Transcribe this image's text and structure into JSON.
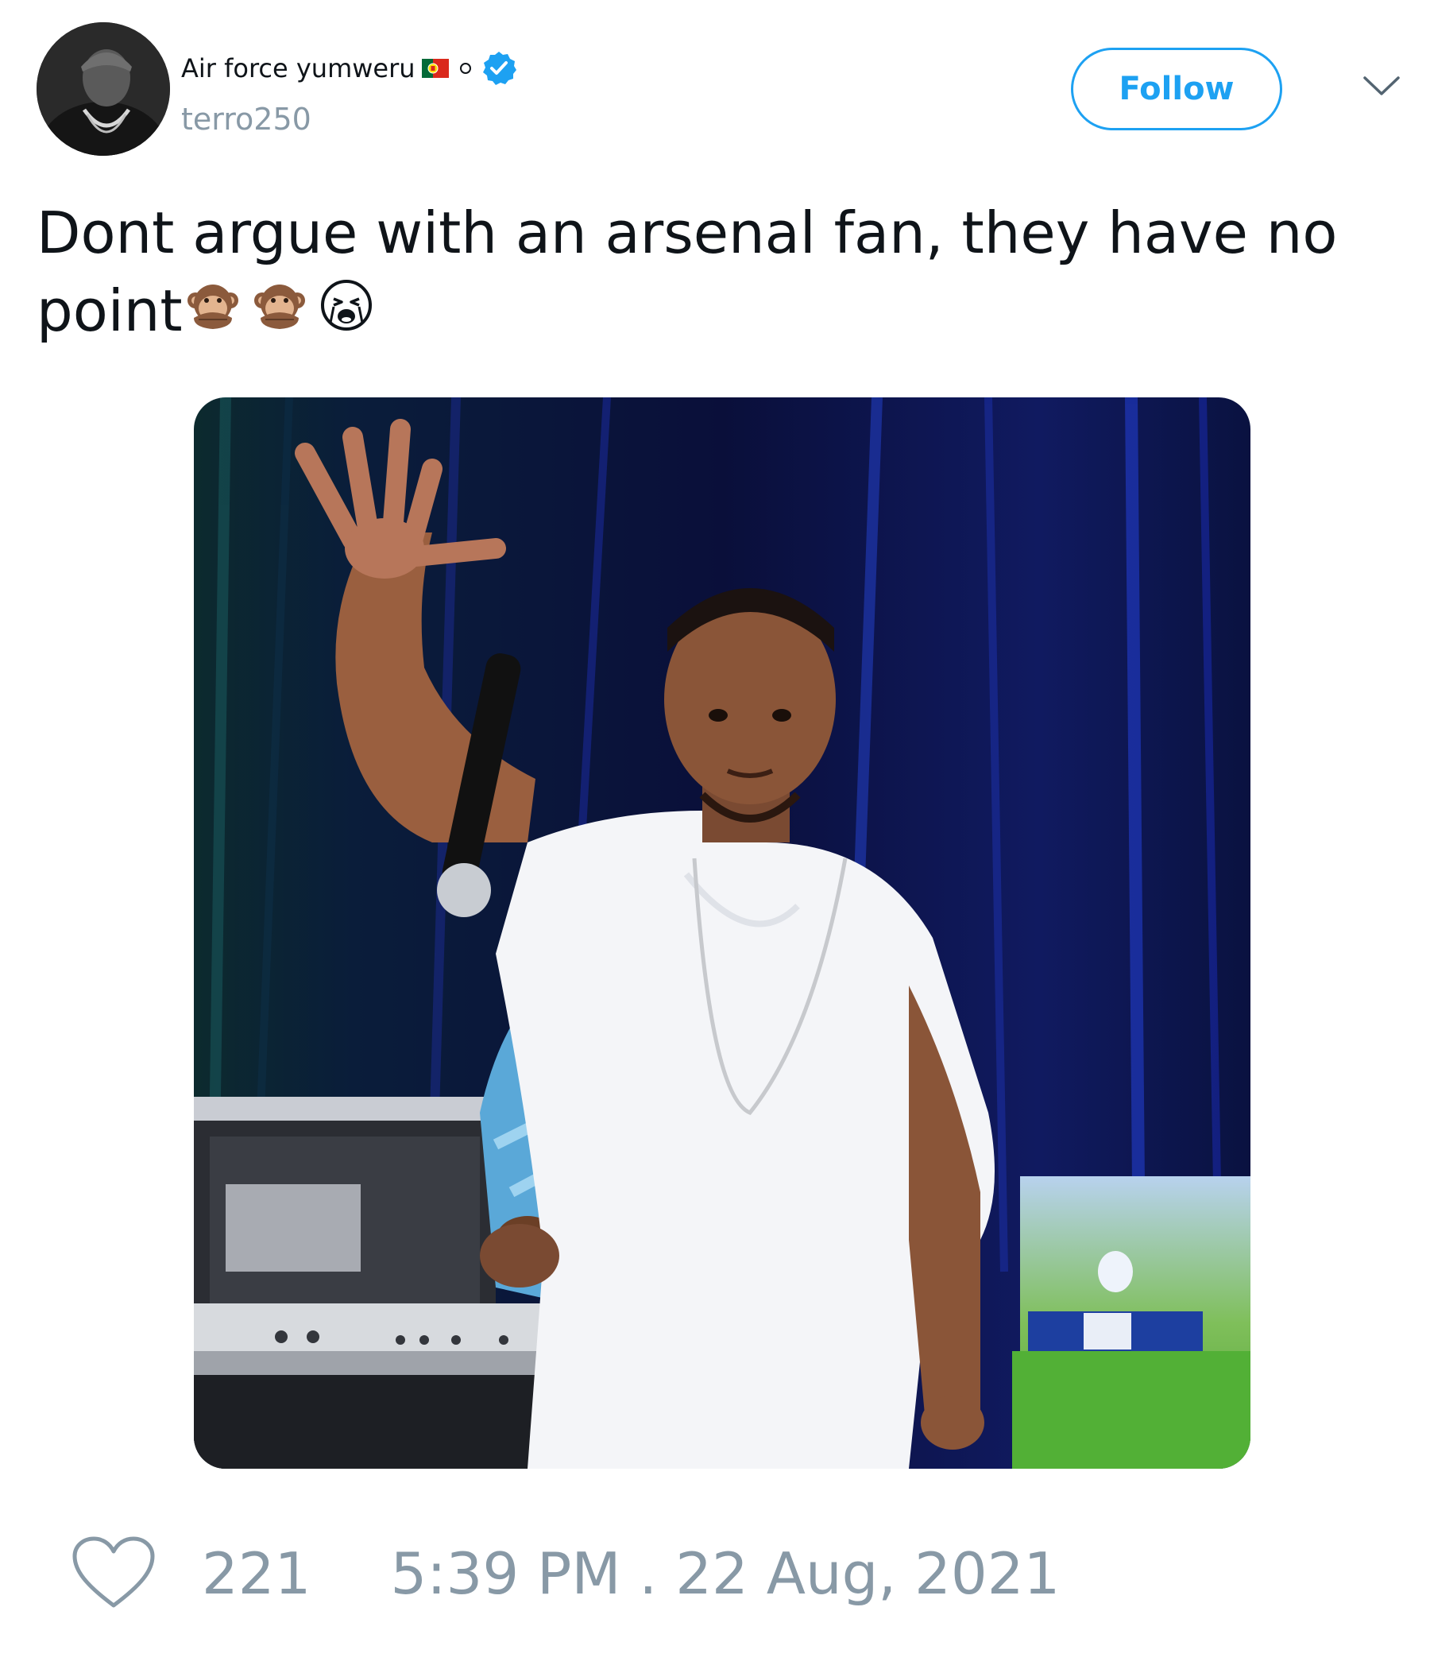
{
  "author": {
    "display_name": "Air force yumweru",
    "handle": "terro250",
    "avatar_icon": "avatar-photo",
    "flag_icon": "portugal-flag-icon",
    "verified_icon": "verified-badge-icon",
    "verified_color": "#1da1f2"
  },
  "actions": {
    "follow_label": "Follow",
    "menu_icon": "chevron-down-icon",
    "accent_color": "#1da1f2"
  },
  "tweet": {
    "text": "Dont argue with an arsenal fan, they have no point",
    "emojis": [
      "speak-no-evil-monkey",
      "speak-no-evil-monkey",
      "loudly-crying-face"
    ]
  },
  "media": {
    "photo_icon": "tweet-photo"
  },
  "footer": {
    "like_icon": "heart-icon",
    "likes": "221",
    "timestamp": "5:39 PM . 22 Aug, 2021",
    "muted_color": "#8899a6"
  }
}
